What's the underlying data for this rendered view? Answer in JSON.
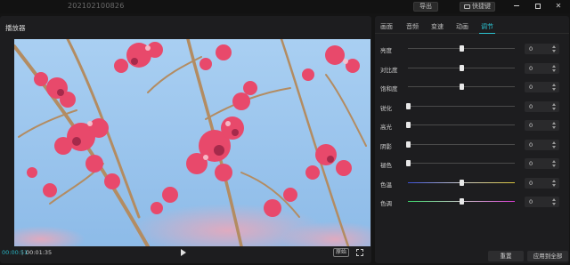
{
  "window": {
    "doc_title": "202102100826",
    "export_label": "导出",
    "shortcut_label": "快捷键"
  },
  "player": {
    "title": "播放器",
    "time_current": "00:00:51",
    "time_separator": "|",
    "time_total": "00:01:35",
    "ratio_label": "原始"
  },
  "adjust": {
    "tabs": [
      {
        "label": "画面",
        "active": false
      },
      {
        "label": "音频",
        "active": false
      },
      {
        "label": "变速",
        "active": false
      },
      {
        "label": "动画",
        "active": false
      },
      {
        "label": "调节",
        "active": true
      }
    ],
    "sliders": [
      {
        "label": "亮度",
        "value": "0",
        "position": 0.5,
        "track": "plain"
      },
      {
        "label": "对比度",
        "value": "0",
        "position": 0.5,
        "track": "plain"
      },
      {
        "label": "饱和度",
        "value": "0",
        "position": 0.5,
        "track": "plain"
      },
      {
        "label": "锐化",
        "value": "0",
        "position": 0.0,
        "track": "plain"
      },
      {
        "label": "高光",
        "value": "0",
        "position": 0.0,
        "track": "plain"
      },
      {
        "label": "阴影",
        "value": "0",
        "position": 0.0,
        "track": "plain"
      },
      {
        "label": "褪色",
        "value": "0",
        "position": 0.0,
        "track": "plain"
      },
      {
        "label": "色温",
        "value": "0",
        "position": 0.5,
        "track": "temperature"
      },
      {
        "label": "色调",
        "value": "0",
        "position": 0.5,
        "track": "tint"
      }
    ],
    "reset_label": "重置",
    "apply_all_label": "应用到全部"
  },
  "colors": {
    "accent": "#2bc2d0",
    "panel": "#1d1d1f",
    "background": "#141414"
  }
}
